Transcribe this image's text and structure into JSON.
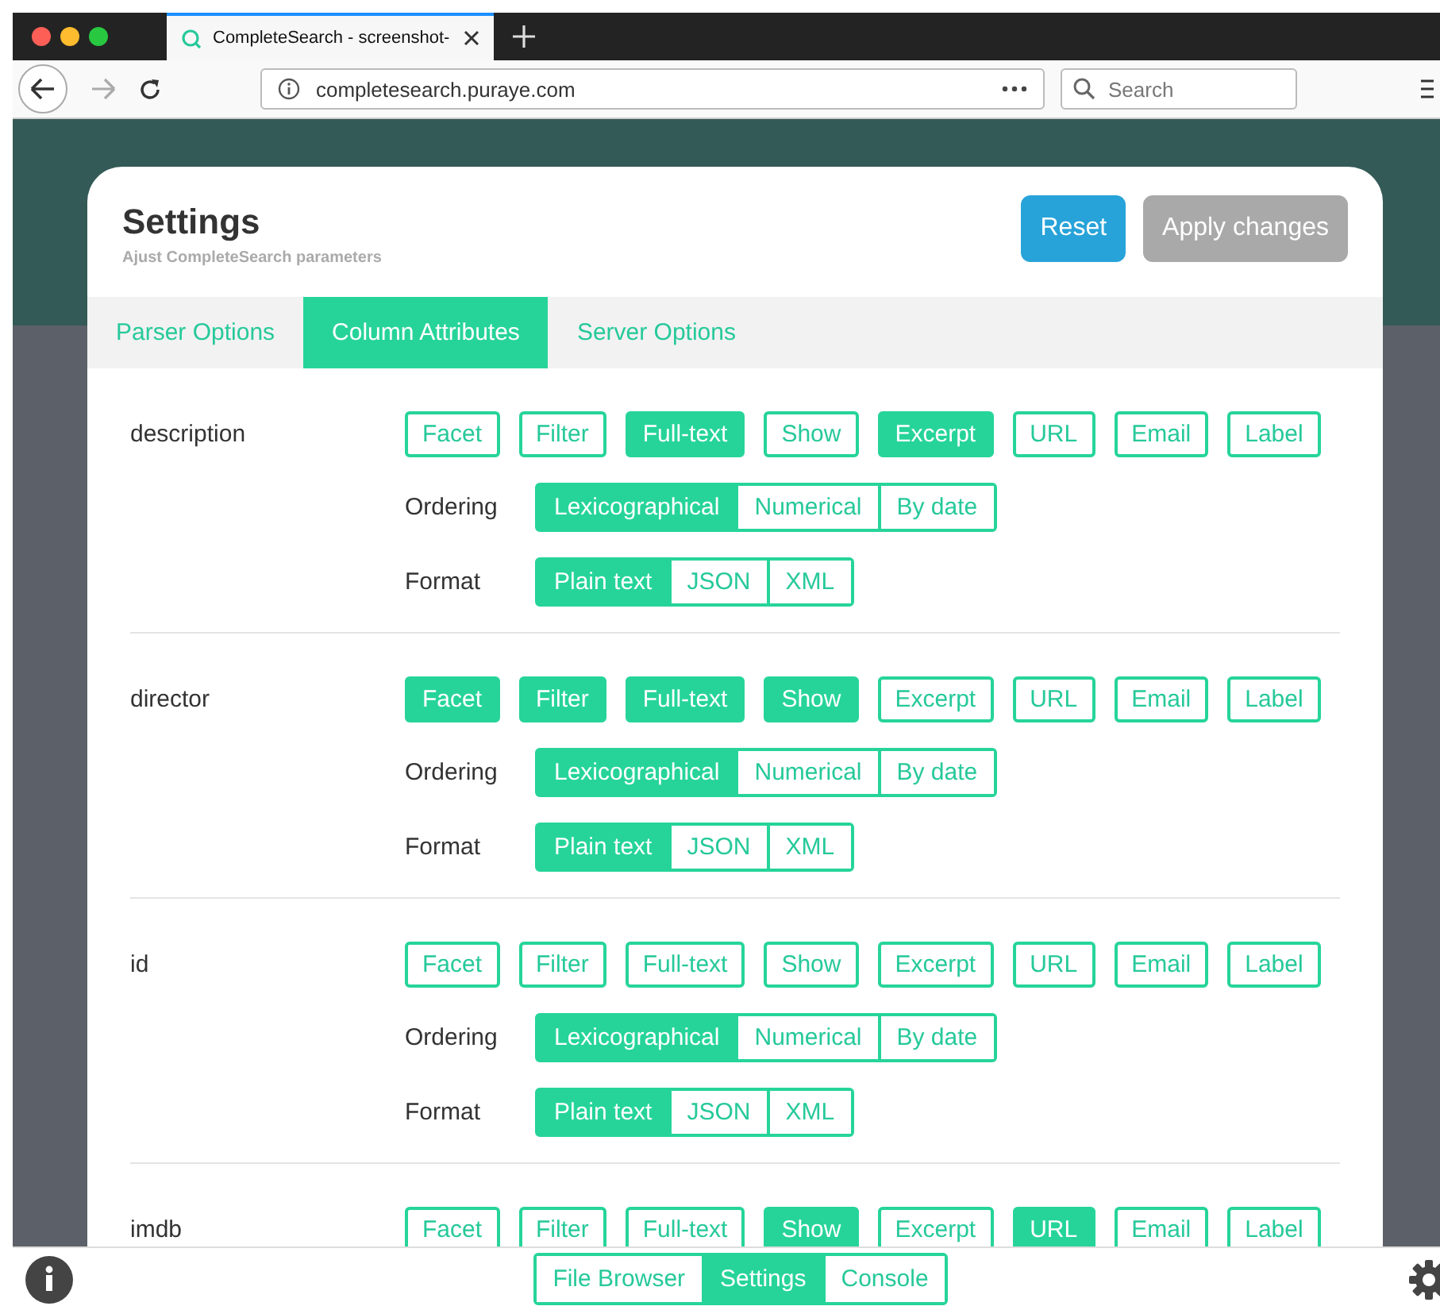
{
  "browser": {
    "tab_title": "CompleteSearch - screenshot-",
    "url": "completesearch.puraye.com",
    "search_placeholder": "Search"
  },
  "dialog": {
    "title": "Settings",
    "subtitle": "Ajust CompleteSearch parameters",
    "buttons": [
      {
        "label": "Reset",
        "disabled": false
      },
      {
        "label": "Apply changes",
        "disabled": true
      }
    ],
    "tabs": [
      {
        "label": "Parser Options",
        "selected": false
      },
      {
        "label": "Column Attributes",
        "selected": true
      },
      {
        "label": "Server Options",
        "selected": false
      }
    ],
    "columns": [
      {
        "name": "description",
        "flags": [
          {
            "label": "Facet",
            "selected": false
          },
          {
            "label": "Filter",
            "selected": false
          },
          {
            "label": "Full-text",
            "selected": true
          },
          {
            "label": "Show",
            "selected": false
          },
          {
            "label": "Excerpt",
            "selected": true
          },
          {
            "label": "URL",
            "selected": false
          },
          {
            "label": "Email",
            "selected": false
          },
          {
            "label": "Label",
            "selected": false
          }
        ],
        "ordering": {
          "label": "Ordering",
          "options": [
            {
              "label": "Lexicographical",
              "selected": true
            },
            {
              "label": "Numerical",
              "selected": false
            },
            {
              "label": "By date",
              "selected": false
            }
          ]
        },
        "format": {
          "label": "Format",
          "options": [
            {
              "label": "Plain text",
              "selected": true
            },
            {
              "label": "JSON",
              "selected": false
            },
            {
              "label": "XML",
              "selected": false
            }
          ]
        }
      },
      {
        "name": "director",
        "flags": [
          {
            "label": "Facet",
            "selected": true
          },
          {
            "label": "Filter",
            "selected": true
          },
          {
            "label": "Full-text",
            "selected": true
          },
          {
            "label": "Show",
            "selected": true
          },
          {
            "label": "Excerpt",
            "selected": false
          },
          {
            "label": "URL",
            "selected": false
          },
          {
            "label": "Email",
            "selected": false
          },
          {
            "label": "Label",
            "selected": false
          }
        ],
        "ordering": {
          "label": "Ordering",
          "options": [
            {
              "label": "Lexicographical",
              "selected": true
            },
            {
              "label": "Numerical",
              "selected": false
            },
            {
              "label": "By date",
              "selected": false
            }
          ]
        },
        "format": {
          "label": "Format",
          "options": [
            {
              "label": "Plain text",
              "selected": true
            },
            {
              "label": "JSON",
              "selected": false
            },
            {
              "label": "XML",
              "selected": false
            }
          ]
        }
      },
      {
        "name": "id",
        "flags": [
          {
            "label": "Facet",
            "selected": false
          },
          {
            "label": "Filter",
            "selected": false
          },
          {
            "label": "Full-text",
            "selected": false
          },
          {
            "label": "Show",
            "selected": false
          },
          {
            "label": "Excerpt",
            "selected": false
          },
          {
            "label": "URL",
            "selected": false
          },
          {
            "label": "Email",
            "selected": false
          },
          {
            "label": "Label",
            "selected": false
          }
        ],
        "ordering": {
          "label": "Ordering",
          "options": [
            {
              "label": "Lexicographical",
              "selected": true
            },
            {
              "label": "Numerical",
              "selected": false
            },
            {
              "label": "By date",
              "selected": false
            }
          ]
        },
        "format": {
          "label": "Format",
          "options": [
            {
              "label": "Plain text",
              "selected": true
            },
            {
              "label": "JSON",
              "selected": false
            },
            {
              "label": "XML",
              "selected": false
            }
          ]
        }
      },
      {
        "name": "imdb",
        "flags": [
          {
            "label": "Facet",
            "selected": false
          },
          {
            "label": "Filter",
            "selected": false
          },
          {
            "label": "Full-text",
            "selected": false
          },
          {
            "label": "Show",
            "selected": true
          },
          {
            "label": "Excerpt",
            "selected": false
          },
          {
            "label": "URL",
            "selected": true
          },
          {
            "label": "Email",
            "selected": false
          },
          {
            "label": "Label",
            "selected": false
          }
        ]
      }
    ]
  },
  "bottom_bar": {
    "views": [
      {
        "label": "File Browser",
        "selected": false
      },
      {
        "label": "Settings",
        "selected": true
      },
      {
        "label": "Console",
        "selected": false
      }
    ]
  }
}
